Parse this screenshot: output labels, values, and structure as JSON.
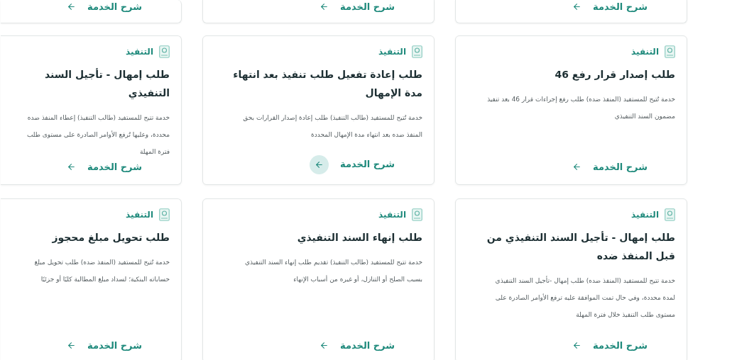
{
  "rows": [
    {
      "cards": [
        {
          "link": {
            "label": "شرح الخدمة",
            "highlighted": false
          }
        },
        {
          "link": {
            "label": "شرح الخدمة",
            "highlighted": false
          }
        },
        {
          "link": {
            "label": "شرح الخدمة",
            "highlighted": false
          }
        }
      ]
    },
    {
      "cards": [
        {
          "category": "التنفيذ",
          "title": "طلب إصدار قرار رفع 46",
          "description_lines": [
            "خدمة تُتيح للمستفيد (المنفذ ضده) طلب رفع إجراءات قرار 46 بعد تنفيذ",
            "مضمون السند التنفيذي"
          ],
          "link": {
            "label": "شرح الخدمة",
            "highlighted": false
          }
        },
        {
          "category": "التنفيذ",
          "title": "طلب إعادة تفعيل طلب تنفيذ بعد انتهاء مدة الإمهال",
          "description_lines": [
            "خدمة تُتيح للمستفيد (طالب التنفيذ) طلب إعادة إصدار القرارات بحق",
            "المنفذ ضده بعد انتهاء مدة الإمهال المحددة"
          ],
          "link": {
            "label": "شرح الخدمة",
            "highlighted": true
          }
        },
        {
          "category": "التنفيذ",
          "title": "طلب إمهال - تأجيل السند التنفيذي",
          "description_lines": [
            "خدمة تتيح للمستفيد (طالب التنفيذ) إعطاء المنفذ ضده",
            "محددة، وعليها تُرفع الأوامر الصادرة على مستوى طلب",
            "فترة المهلة"
          ],
          "link": {
            "label": "شرح الخدمة",
            "highlighted": false
          }
        }
      ]
    },
    {
      "cards": [
        {
          "category": "التنفيذ",
          "title": "طلب إمهال - تأجيل السند التنفيذي من قبل المنفذ ضده",
          "description_lines": [
            "خدمة تتيح للمستفيد (المنفذ ضده) طلب إمهال -تأجيل السند التنفيذي",
            "لمدة محددة، وفي حال تمت الموافقة عليه ترفع الأوامر الصادرة على",
            "مستوى طلب التنفيذ خلال فترة المهلة"
          ],
          "link": {
            "label": "شرح الخدمة",
            "highlighted": false
          }
        },
        {
          "category": "التنفيذ",
          "title": "طلب إنهاء السند التنفيذي",
          "description_lines": [
            "خدمة تتيح للمستفيد (طالب التنفيذ) تقديم طلب إنهاء السند التنفيذي",
            "بسبب الصلح أو التنازل، أو غيره من أسباب الإنهاء"
          ],
          "link": {
            "label": "شرح الخدمة",
            "highlighted": false
          }
        },
        {
          "category": "التنفيذ",
          "title": "طلب تحويل مبلغ محجوز",
          "description_lines": [
            "خدمة تُتيح للمستفيد (المنفذ ضده) طلب تحويل مبلغ",
            "حساباته البنكية؛ لسداد مبلغ المطالبة كليًا أو جزئيًا"
          ],
          "link": {
            "label": "شرح الخدمة",
            "highlighted": false
          }
        }
      ]
    }
  ]
}
